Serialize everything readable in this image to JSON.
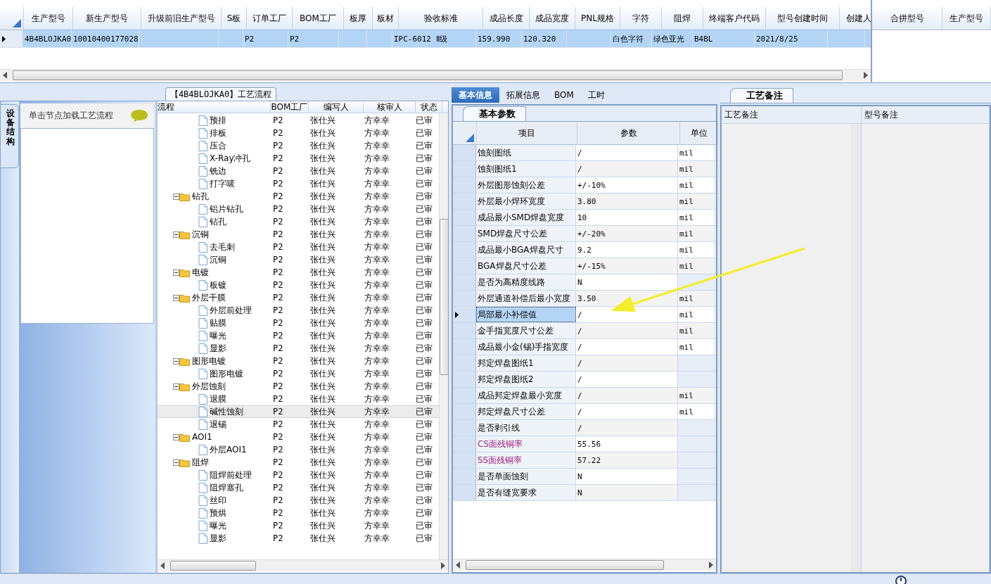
{
  "top_grid": {
    "columns": [
      "生产型号",
      "新生产型号",
      "升级前旧生产型号",
      "S板",
      "订单工厂",
      "BOM工厂",
      "板厚",
      "板材",
      "验收标准",
      "成品长度",
      "成品宽度",
      "PNL规格",
      "字符",
      "阻焊",
      "终端客户代码",
      "型号创建时间",
      "创建人"
    ],
    "rows": [
      {
        "selected": true,
        "cells": [
          "4B4BLOJKA0",
          "10010400177028",
          "",
          "",
          "P2",
          "P2",
          "",
          "",
          "IPC-6012 Ⅱ级",
          "159.990",
          "120.320",
          "",
          "白色字符",
          "绿色亚光",
          "B4BL",
          "2021/8/25",
          ""
        ]
      }
    ]
  },
  "side_grid": {
    "columns": [
      "合拼型号",
      "生产型号"
    ]
  },
  "flow_panel": {
    "title": "【4B4BLOJKA0】工艺流程",
    "side_tab": "设备结构",
    "hint": "单击节点加载工艺流程",
    "columns": [
      "流程",
      "BOM工厂",
      "编写人",
      "核审人",
      "状态"
    ],
    "tree": [
      {
        "kind": "hidden",
        "children": [
          {
            "kind": "file",
            "name": "预排",
            "bom": "P2",
            "writer": "张仕兴",
            "reviewer": "方幸幸",
            "status": "已审",
            "selected": false
          },
          {
            "kind": "file",
            "name": "排板",
            "bom": "P2",
            "writer": "张仕兴",
            "reviewer": "方幸幸",
            "status": "已审",
            "selected": false
          },
          {
            "kind": "file",
            "name": "压合",
            "bom": "P2",
            "writer": "张仕兴",
            "reviewer": "方幸幸",
            "status": "已审",
            "selected": false
          },
          {
            "kind": "file",
            "name": "X-Ray冲孔",
            "bom": "P2",
            "writer": "张仕兴",
            "reviewer": "方幸幸",
            "status": "已审",
            "selected": false
          },
          {
            "kind": "file",
            "name": "铣边",
            "bom": "P2",
            "writer": "张仕兴",
            "reviewer": "方幸幸",
            "status": "已审",
            "selected": false
          },
          {
            "kind": "file",
            "name": "打字唛",
            "bom": "P2",
            "writer": "张仕兴",
            "reviewer": "方幸幸",
            "status": "已审",
            "selected": false
          }
        ]
      },
      {
        "kind": "folder",
        "name": "钻孔",
        "bom": "P2",
        "writer": "张仕兴",
        "reviewer": "方幸幸",
        "status": "已审",
        "selected": false,
        "children": [
          {
            "kind": "file",
            "name": "铝片钻孔",
            "bom": "P2",
            "writer": "张仕兴",
            "reviewer": "方幸幸",
            "status": "已审",
            "selected": false
          },
          {
            "kind": "file",
            "name": "钻孔",
            "bom": "P2",
            "writer": "张仕兴",
            "reviewer": "方幸幸",
            "status": "已审",
            "selected": false
          }
        ]
      },
      {
        "kind": "folder",
        "name": "沉铜",
        "bom": "P2",
        "writer": "张仕兴",
        "reviewer": "方幸幸",
        "status": "已审",
        "selected": false,
        "children": [
          {
            "kind": "file",
            "name": "去毛刺",
            "bom": "P2",
            "writer": "张仕兴",
            "reviewer": "方幸幸",
            "status": "已审",
            "selected": false
          },
          {
            "kind": "file",
            "name": "沉铜",
            "bom": "P2",
            "writer": "张仕兴",
            "reviewer": "方幸幸",
            "status": "已审",
            "selected": false
          }
        ]
      },
      {
        "kind": "folder",
        "name": "电镀",
        "bom": "P2",
        "writer": "张仕兴",
        "reviewer": "方幸幸",
        "status": "已审",
        "selected": false,
        "children": [
          {
            "kind": "file",
            "name": "板镀",
            "bom": "P2",
            "writer": "张仕兴",
            "reviewer": "方幸幸",
            "status": "已审",
            "selected": false
          }
        ]
      },
      {
        "kind": "folder",
        "name": "外层干膜",
        "bom": "P2",
        "writer": "张仕兴",
        "reviewer": "方幸幸",
        "status": "已审",
        "selected": false,
        "children": [
          {
            "kind": "file",
            "name": "外层前处理",
            "bom": "P2",
            "writer": "张仕兴",
            "reviewer": "方幸幸",
            "status": "已审",
            "selected": false
          },
          {
            "kind": "file",
            "name": "贴膜",
            "bom": "P2",
            "writer": "张仕兴",
            "reviewer": "方幸幸",
            "status": "已审",
            "selected": false
          },
          {
            "kind": "file",
            "name": "曝光",
            "bom": "P2",
            "writer": "张仕兴",
            "reviewer": "方幸幸",
            "status": "已审",
            "selected": false
          },
          {
            "kind": "file",
            "name": "显影",
            "bom": "P2",
            "writer": "张仕兴",
            "reviewer": "方幸幸",
            "status": "已审",
            "selected": false
          }
        ]
      },
      {
        "kind": "folder",
        "name": "图形电镀",
        "bom": "P2",
        "writer": "张仕兴",
        "reviewer": "方幸幸",
        "status": "已审",
        "selected": false,
        "children": [
          {
            "kind": "file",
            "name": "图形电镀",
            "bom": "P2",
            "writer": "张仕兴",
            "reviewer": "方幸幸",
            "status": "已审",
            "selected": false
          }
        ]
      },
      {
        "kind": "folder",
        "name": "外层蚀刻",
        "bom": "P2",
        "writer": "张仕兴",
        "reviewer": "方幸幸",
        "status": "已审",
        "selected": false,
        "children": [
          {
            "kind": "file",
            "name": "退膜",
            "bom": "P2",
            "writer": "张仕兴",
            "reviewer": "方幸幸",
            "status": "已审",
            "selected": false
          },
          {
            "kind": "file",
            "name": "碱性蚀刻",
            "bom": "P2",
            "writer": "张仕兴",
            "reviewer": "方幸幸",
            "status": "已审",
            "selected": true
          },
          {
            "kind": "file",
            "name": "退锡",
            "bom": "P2",
            "writer": "张仕兴",
            "reviewer": "方幸幸",
            "status": "已审",
            "selected": false
          }
        ]
      },
      {
        "kind": "folder",
        "name": "AOI1",
        "bom": "P2",
        "writer": "张仕兴",
        "reviewer": "方幸幸",
        "status": "已审",
        "selected": false,
        "children": [
          {
            "kind": "file",
            "name": "外层AOI1",
            "bom": "P2",
            "writer": "张仕兴",
            "reviewer": "方幸幸",
            "status": "已审",
            "selected": false
          }
        ]
      },
      {
        "kind": "folder",
        "name": "阻焊",
        "bom": "P2",
        "writer": "张仕兴",
        "reviewer": "方幸幸",
        "status": "已审",
        "selected": false,
        "children": [
          {
            "kind": "file",
            "name": "阻焊前处理",
            "bom": "P2",
            "writer": "张仕兴",
            "reviewer": "方幸幸",
            "status": "已审",
            "selected": false
          },
          {
            "kind": "file",
            "name": "阻焊塞孔",
            "bom": "P2",
            "writer": "张仕兴",
            "reviewer": "方幸幸",
            "status": "已审",
            "selected": false
          },
          {
            "kind": "file",
            "name": "丝印",
            "bom": "P2",
            "writer": "张仕兴",
            "reviewer": "方幸幸",
            "status": "已审",
            "selected": false
          },
          {
            "kind": "file",
            "name": "预烘",
            "bom": "P2",
            "writer": "张仕兴",
            "reviewer": "方幸幸",
            "status": "已审",
            "selected": false
          },
          {
            "kind": "file",
            "name": "曝光",
            "bom": "P2",
            "writer": "张仕兴",
            "reviewer": "方幸幸",
            "status": "已审",
            "selected": false
          },
          {
            "kind": "file",
            "name": "显影",
            "bom": "P2",
            "writer": "张仕兴",
            "reviewer": "方幸幸",
            "status": "已审",
            "selected": false
          }
        ]
      }
    ]
  },
  "info_panel": {
    "tabs": [
      {
        "label": "基本信息",
        "selected": true
      },
      {
        "label": "拓展信息",
        "selected": false
      },
      {
        "label": "BOM",
        "selected": false
      },
      {
        "label": "工时",
        "selected": false
      }
    ],
    "sub_tab": "基本参数",
    "columns": [
      "项目",
      "参数",
      "单位"
    ],
    "rows": [
      {
        "item": "蚀刻图纸",
        "value": "/",
        "unit": "mil",
        "selected": false
      },
      {
        "item": "蚀刻图纸1",
        "value": "/",
        "unit": "mil",
        "selected": false
      },
      {
        "item": "外层图形蚀刻公差",
        "value": "+/-10%",
        "unit": "mil",
        "selected": false
      },
      {
        "item": "外层最小焊环宽度",
        "value": "3.80",
        "unit": "mil",
        "selected": false
      },
      {
        "item": "成品最小SMD焊盘宽度",
        "value": "10",
        "unit": "mil",
        "selected": false
      },
      {
        "item": "SMD焊盘尺寸公差",
        "value": "+/-20%",
        "unit": "mil",
        "selected": false
      },
      {
        "item": "成品最小BGA焊盘尺寸",
        "value": "9.2",
        "unit": "mil",
        "selected": false
      },
      {
        "item": "BGA焊盘尺寸公差",
        "value": "+/-15%",
        "unit": "mil",
        "selected": false
      },
      {
        "item": "是否为高精度线路",
        "value": "N",
        "selected": false
      },
      {
        "item": "外层通道补偿后最小宽度",
        "value": "3.50",
        "unit": "mil",
        "selected": false
      },
      {
        "item": "局部最小补偿值",
        "value": "/",
        "unit": "mil",
        "selected": true
      },
      {
        "item": "金手指宽度尺寸公差",
        "value": "/",
        "unit": "mil",
        "selected": false
      },
      {
        "item": "成品最小金(锡)手指宽度",
        "value": "/",
        "unit": "mil",
        "selected": false
      },
      {
        "item": "邦定焊盘图纸1",
        "value": "/",
        "selected": false
      },
      {
        "item": "邦定焊盘图纸2",
        "value": "/",
        "selected": false
      },
      {
        "item": "成品邦定焊盘最小宽度",
        "value": "/",
        "unit": "mil",
        "selected": false
      },
      {
        "item": "邦定焊盘尺寸公差",
        "value": "/",
        "unit": "mil",
        "selected": false
      },
      {
        "item": "是否剥引线",
        "value": "/",
        "selected": false
      },
      {
        "item": "CS面残铜率",
        "value": "55.56",
        "color": "#a0207f",
        "selected": false
      },
      {
        "item": "SS面残铜率",
        "value": "57.22",
        "color": "#a0207f",
        "selected": false
      },
      {
        "item": "是否单面蚀刻",
        "value": "N",
        "selected": false
      },
      {
        "item": "是否有缝宽要求",
        "value": "N",
        "selected": false
      }
    ]
  },
  "remarks_panel": {
    "tab": "工艺备注",
    "columns": [
      "工艺备注",
      "型号备注"
    ]
  }
}
